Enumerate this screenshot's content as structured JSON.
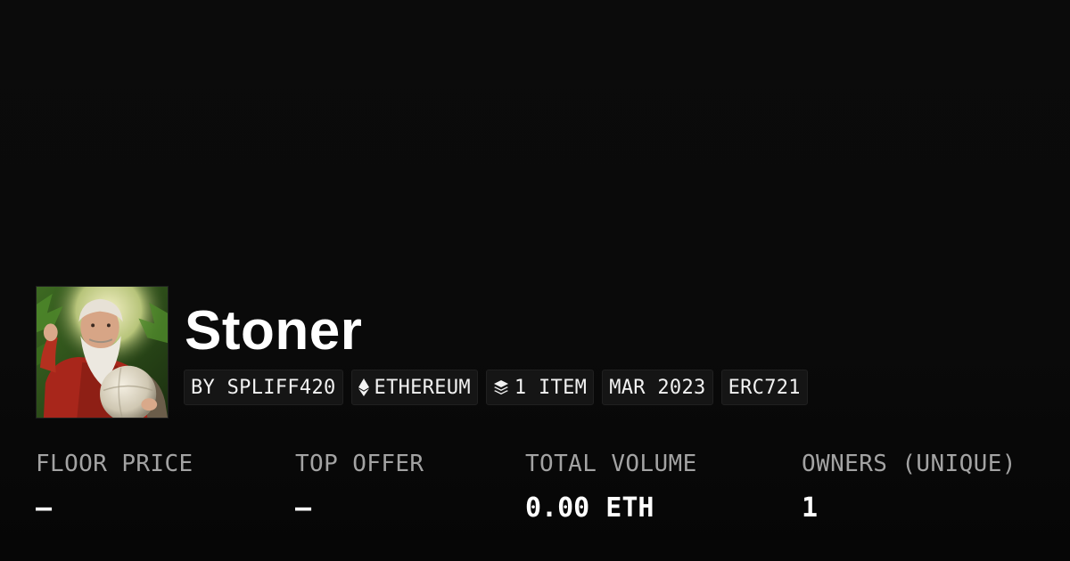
{
  "collection": {
    "name": "Stoner",
    "avatar_icon": "collection-avatar"
  },
  "tags": {
    "creator": "BY SPLIFF420",
    "chain": "ETHEREUM",
    "chain_icon": "ethereum-icon",
    "items": "1 ITEM",
    "items_icon": "layers-icon",
    "date": "MAR 2023",
    "standard": "ERC721"
  },
  "stats": {
    "floor_price": {
      "label": "FLOOR PRICE",
      "value": "–"
    },
    "top_offer": {
      "label": "TOP OFFER",
      "value": "–"
    },
    "total_volume": {
      "label": "TOTAL VOLUME",
      "value": "0.00 ETH"
    },
    "owners": {
      "label": "OWNERS (UNIQUE)",
      "value": "1"
    }
  },
  "colors": {
    "background": "#0a0a0a",
    "tag_background": "#151515",
    "label": "#a3a3a3",
    "text": "#ffffff"
  }
}
